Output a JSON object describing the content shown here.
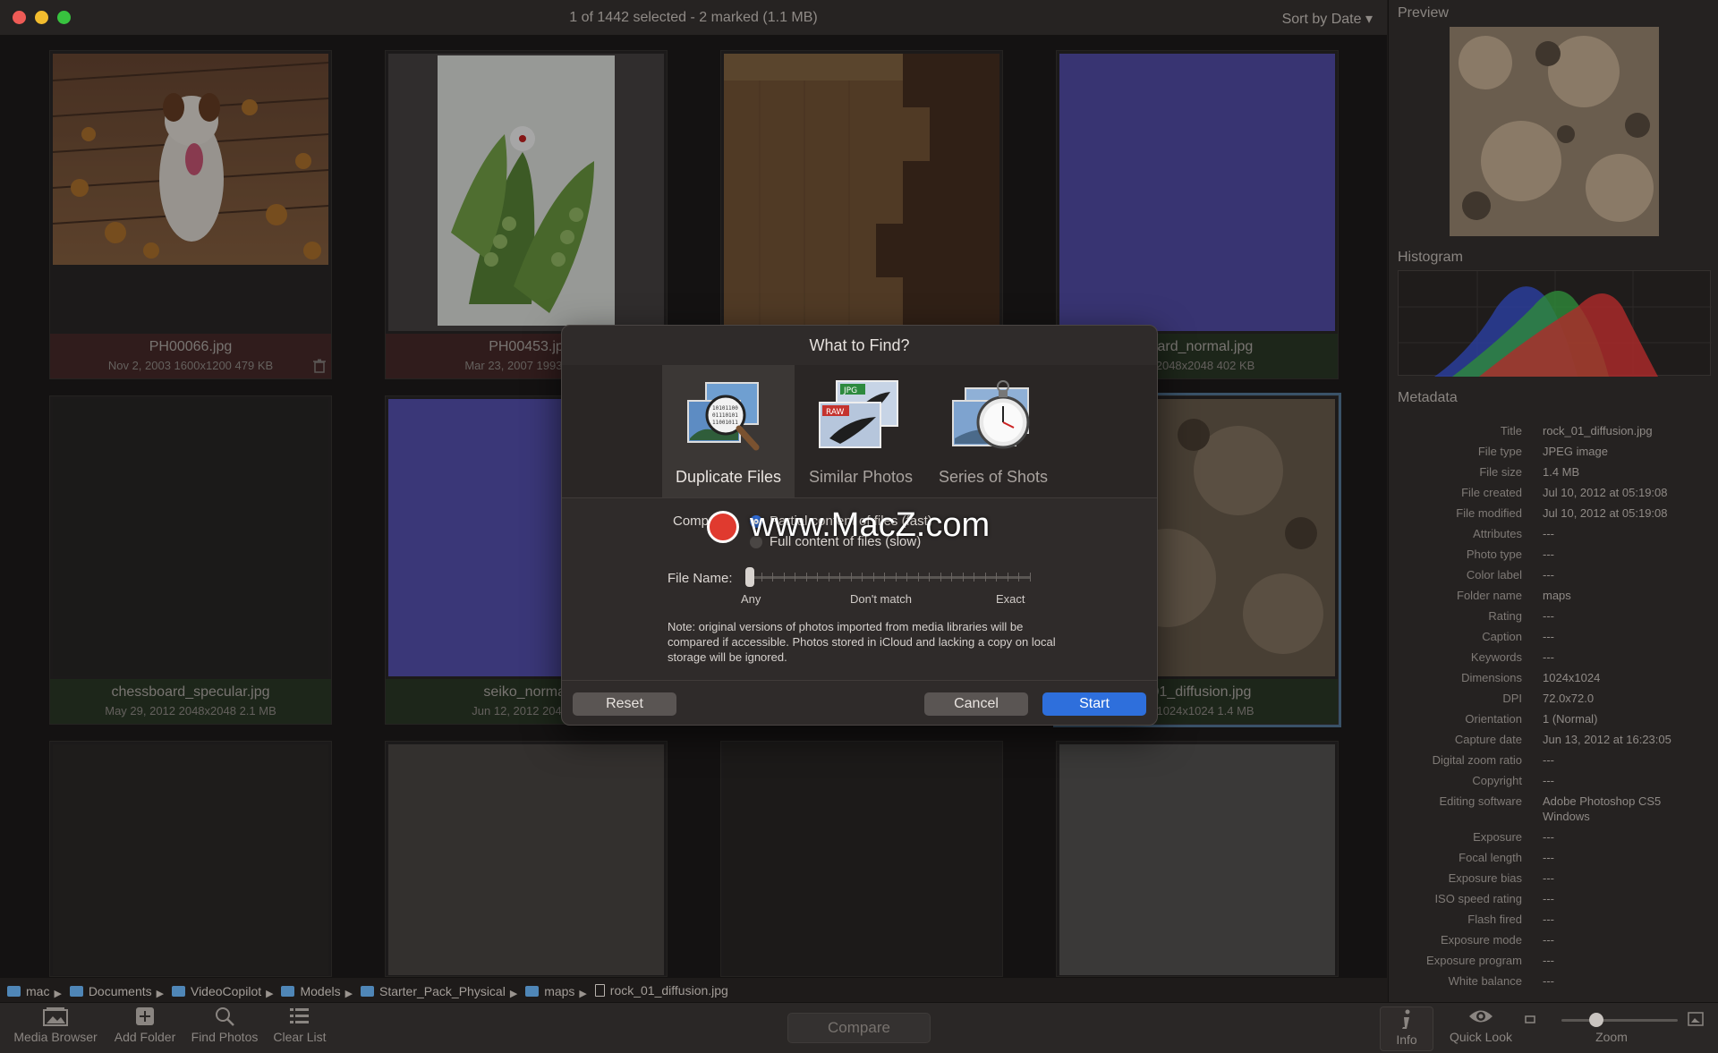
{
  "window": {
    "title": "1 of 1442 selected - 2 marked (1.1 MB)",
    "sort_label": "Sort by Date ▾"
  },
  "grid": {
    "cells": [
      {
        "name": "PH00066.jpg",
        "meta": "Nov 2, 2003  1600x1200  479 KB"
      },
      {
        "name": "PH00453.jp",
        "meta": "Mar 23, 2007  1993x300"
      },
      {
        "name": "",
        "meta": ""
      },
      {
        "name": "board_normal.jpg",
        "meta": "12  2048x2048  402 KB"
      },
      {
        "name": "chessboard_specular.jpg",
        "meta": "May 29, 2012  2048x2048  2.1 MB"
      },
      {
        "name": "seiko_normal",
        "meta": "Jun 12, 2012  2048x2"
      },
      {
        "name": "",
        "meta": ""
      },
      {
        "name": "_01_diffusion.jpg",
        "meta": "12  1024x1024  1.4 MB"
      },
      {
        "name": "",
        "meta": ""
      },
      {
        "name": "",
        "meta": ""
      },
      {
        "name": "",
        "meta": ""
      },
      {
        "name": "",
        "meta": ""
      }
    ]
  },
  "right_panel": {
    "preview_title": "Preview",
    "histogram_title": "Histogram",
    "metadata_title": "Metadata",
    "metadata": [
      {
        "k": "Title",
        "v": "rock_01_diffusion.jpg"
      },
      {
        "k": "File type",
        "v": "JPEG image"
      },
      {
        "k": "File size",
        "v": "1.4 MB"
      },
      {
        "k": "File created",
        "v": "Jul 10, 2012 at 05:19:08"
      },
      {
        "k": "File modified",
        "v": "Jul 10, 2012 at 05:19:08"
      },
      {
        "k": "Attributes",
        "v": "---"
      },
      {
        "k": "Photo type",
        "v": "---"
      },
      {
        "k": "Color label",
        "v": "---"
      },
      {
        "k": "Folder name",
        "v": "maps"
      },
      {
        "k": "Rating",
        "v": "---"
      },
      {
        "k": "Caption",
        "v": "---"
      },
      {
        "k": "Keywords",
        "v": "---"
      },
      {
        "k": "Dimensions",
        "v": "1024x1024"
      },
      {
        "k": "DPI",
        "v": "72.0x72.0"
      },
      {
        "k": "Orientation",
        "v": "1 (Normal)"
      },
      {
        "k": "Capture date",
        "v": "Jun 13, 2012 at 16:23:05"
      },
      {
        "k": "Digital zoom ratio",
        "v": "---"
      },
      {
        "k": "Copyright",
        "v": "---"
      },
      {
        "k": "Editing software",
        "v": "Adobe Photoshop CS5"
      },
      {
        "k": "",
        "v": "Windows"
      },
      {
        "k": "Exposure",
        "v": "---"
      },
      {
        "k": "Focal length",
        "v": "---"
      },
      {
        "k": "Exposure bias",
        "v": "---"
      },
      {
        "k": "ISO speed rating",
        "v": "---"
      },
      {
        "k": "Flash fired",
        "v": "---"
      },
      {
        "k": "Exposure mode",
        "v": "---"
      },
      {
        "k": "Exposure program",
        "v": "---"
      },
      {
        "k": "White balance",
        "v": "---"
      }
    ]
  },
  "breadcrumb": [
    "mac",
    "Documents",
    "VideoCopilot",
    "Models",
    "Starter_Pack_Physical",
    "maps",
    "rock_01_diffusion.jpg"
  ],
  "toolbar": {
    "media_browser": "Media Browser",
    "add_folder": "Add Folder",
    "find_photos": "Find Photos",
    "clear_list": "Clear List",
    "compare": "Compare",
    "info": "Info",
    "quick_look": "Quick Look",
    "zoom": "Zoom",
    "zoom_level": 0.3
  },
  "dialog": {
    "title": "What to Find?",
    "tabs": [
      "Duplicate Files",
      "Similar Photos",
      "Series of Shots"
    ],
    "active_tab": "Duplicate Files",
    "compare_label": "Comp",
    "option_partial": "Partial content of files (fast)",
    "option_full": "Full content of files (slow)",
    "file_name_label": "File Name:",
    "slider_any": "Any",
    "slider_mid": "Don't match",
    "slider_exact": "Exact",
    "note": "Note: original versions of photos imported from media libraries will be compared if accessible. Photos stored in iCloud and lacking a copy on local storage will be ignored.",
    "reset": "Reset",
    "cancel": "Cancel",
    "start": "Start"
  },
  "watermark": "www.MacZ.com",
  "colors": {
    "accent_blue": "#2e6fdc",
    "marked_red": "#4a2b2b",
    "marked_green": "#2d3b28",
    "selection": "#5a7fa0"
  }
}
